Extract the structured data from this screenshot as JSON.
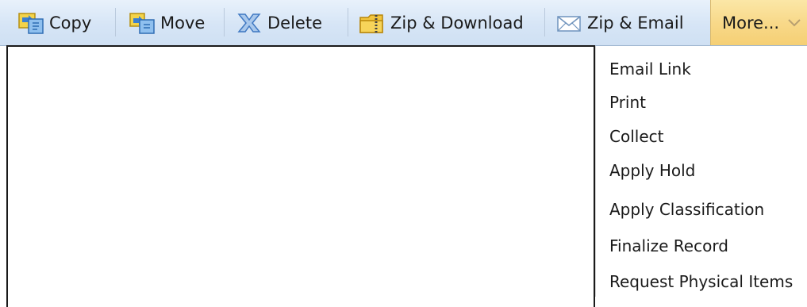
{
  "toolbar": {
    "copy_label": "Copy",
    "move_label": "Move",
    "delete_label": "Delete",
    "zip_download_label": "Zip & Download",
    "zip_email_label": "Zip & Email",
    "more_label": "More...",
    "icons": {
      "copy": "copy-icon",
      "move": "move-icon",
      "delete": "delete-icon",
      "zip_download": "zip-folder-icon",
      "zip_email": "envelope-icon",
      "more": "chevron-down-icon"
    },
    "colors": {
      "toolbar_bg": "#d6e5f6",
      "more_bg": "#f8d98a"
    }
  },
  "more_menu": {
    "items": [
      "Email Link",
      "Print",
      "Collect",
      "Apply Hold",
      "Apply Classification",
      "Finalize Record",
      "Request Physical Items"
    ]
  }
}
